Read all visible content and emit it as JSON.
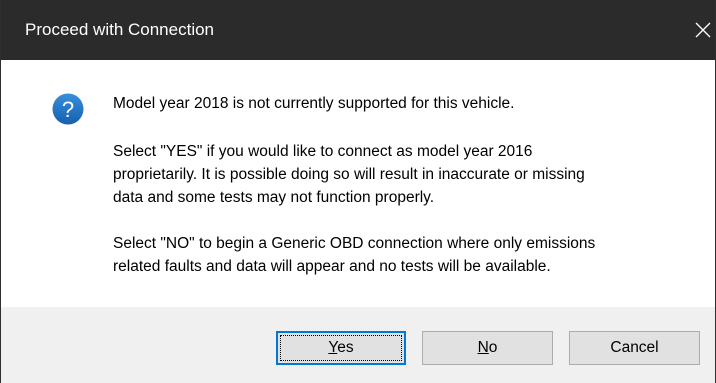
{
  "dialog": {
    "title": "Proceed with Connection",
    "icon": "question-icon",
    "close_icon": "close-icon"
  },
  "message": {
    "line1": "Model year 2018 is not currently supported for this vehicle.",
    "paragraph2": "Select \"YES\" if you would like to connect as model year 2016\nproprietarily.  It is possible doing so will result in inaccurate or missing\ndata and some tests may not function properly.",
    "paragraph3": "Select \"NO\" to begin a Generic OBD connection where only emissions\nrelated faults and data will appear and no tests will be available."
  },
  "buttons": {
    "yes": {
      "mnemonic": "Y",
      "rest": "es"
    },
    "no": {
      "mnemonic": "N",
      "rest": "o"
    },
    "cancel": "Cancel"
  },
  "colors": {
    "titlebar": "#2b2b2b",
    "footer": "#f0f0f0",
    "focus_border": "#0078d7",
    "icon_blue": "#1e73be"
  }
}
